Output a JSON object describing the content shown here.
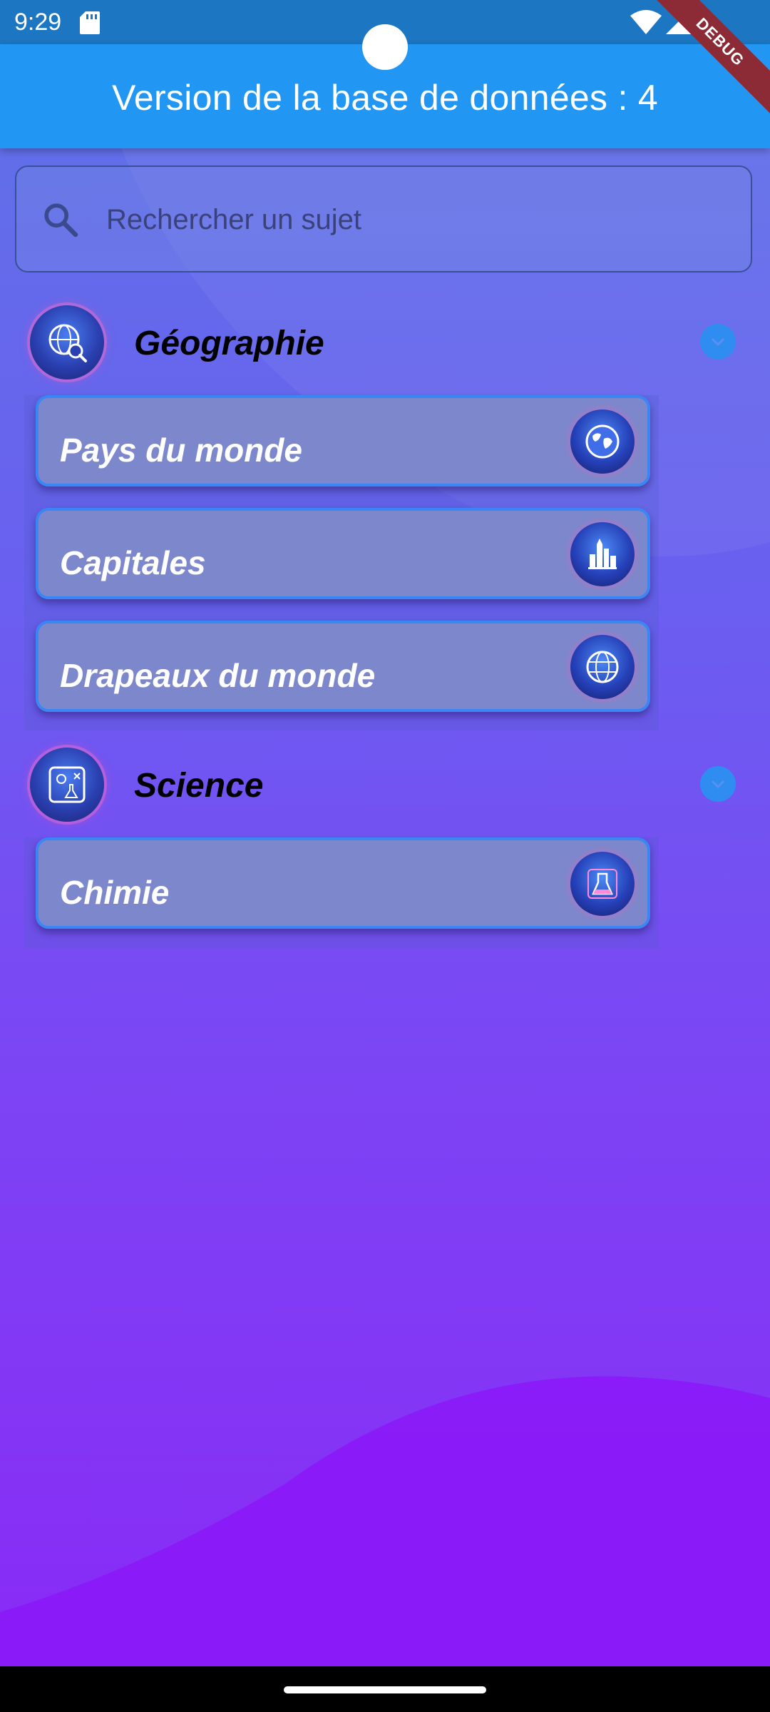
{
  "status_bar": {
    "time": "9:29"
  },
  "app_bar": {
    "title": "Version de la base de données : 4"
  },
  "debug_banner": "DEBUG",
  "search": {
    "placeholder": "Rechercher un sujet"
  },
  "categories": [
    {
      "title": "Géographie",
      "icon": "globe-search-icon",
      "items": [
        {
          "label": "Pays du monde",
          "icon": "world-map-icon"
        },
        {
          "label": "Capitales",
          "icon": "city-skyline-icon"
        },
        {
          "label": "Drapeaux du monde",
          "icon": "flag-globe-icon"
        }
      ]
    },
    {
      "title": "Science",
      "icon": "science-lab-icon",
      "items": [
        {
          "label": "Chimie",
          "icon": "flask-icon"
        }
      ]
    }
  ],
  "colors": {
    "app_bar": "#2196f3",
    "status_bar": "#1d76c2",
    "card_border": "#3a86f5",
    "card_fill": "#7d88cc",
    "debug_banner": "#8c2a35"
  }
}
